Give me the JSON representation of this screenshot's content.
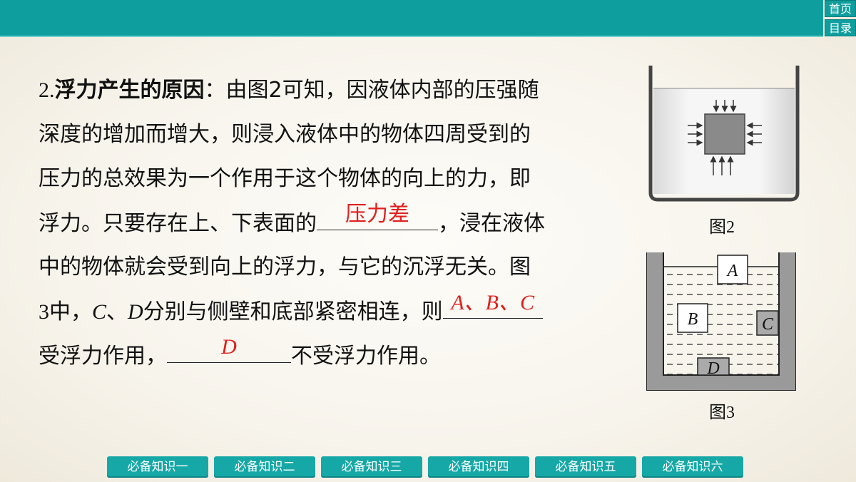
{
  "nav": {
    "home_label": "首页",
    "toc_label": "目录"
  },
  "content": {
    "l1_num": "2.",
    "l1_bold": "浮力产生的原因",
    "l1_rest": "：由图2可知，因液体内部的压强随",
    "l2": "深度的增加而增大，则浸入液体中的物体四周受到的",
    "l3": "压力的总效果为一个作用于这个物体的向上的力，即",
    "l4_pre": "浮力。只要存在上、下表面的",
    "l4_ans": "压力差",
    "l4_post": "，浸在液体",
    "l5": "中的物体就会受到向上的浮力，与它的沉浮无关。图",
    "l6_num": "3",
    "l6_a": "中，",
    "l6_c": "C",
    "l6_sep": "、",
    "l6_d": "D",
    "l6_b": "分别与侧壁和底部紧密相连，则",
    "l6_ans": "A、B、C",
    "l7_a": "受浮力作用，",
    "l7_ans": "D",
    "l7_b": "不受浮力作用。"
  },
  "figures": {
    "fig2_caption": "图2",
    "fig3_caption": "图3",
    "fig3_labels": {
      "a": "A",
      "b": "B",
      "c": "C",
      "d": "D"
    }
  },
  "tabs": [
    "必备知识一",
    "必备知识二",
    "必备知识三",
    "必备知识四",
    "必备知识五",
    "必备知识六"
  ],
  "colors": {
    "bar": "#0f9e9e",
    "answer": "#e0201d"
  }
}
